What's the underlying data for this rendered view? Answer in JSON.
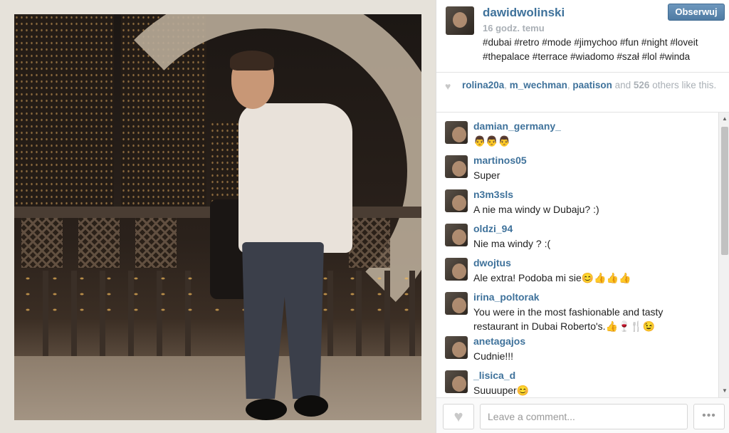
{
  "post": {
    "username": "dawidwolinski",
    "time": "16 godz. temu",
    "caption": "#dubai #retro #mode #jimychoo #fun #night #loveit #thepalace #terrace #wiadomo #szał #lol #winda",
    "follow_label": "Obserwuj"
  },
  "likes": {
    "likers": [
      "rolina20a",
      "m_wechman",
      "paatison"
    ],
    "sep1": ", ",
    "sep2": ", ",
    "and_text": " and ",
    "count": "526",
    "tail": " others like this."
  },
  "comments": [
    {
      "user": "damian_germany_",
      "text": "👨👨👨"
    },
    {
      "user": "martinos05",
      "text": "Super"
    },
    {
      "user": "n3m3sls",
      "text": "A nie ma windy w Dubaju? :)"
    },
    {
      "user": "oldzi_94",
      "text": "Nie ma windy ? :("
    },
    {
      "user": "dwojtus",
      "text": "Ale extra! Podoba mi sie😊👍👍👍"
    },
    {
      "user": "irina_poltorak",
      "text": "You were in the most fashionable and tasty restaurant in Dubai Roberto's.👍🍷🍴😉"
    },
    {
      "user": "anetagajos",
      "text": "Cudnie!!!"
    },
    {
      "user": "_lisica_d",
      "text": "Suuuuper😊"
    }
  ],
  "footer": {
    "comment_placeholder": "Leave a comment...",
    "more_label": "•••"
  },
  "icons": {
    "heart": "heart-icon",
    "more": "more-icon"
  }
}
